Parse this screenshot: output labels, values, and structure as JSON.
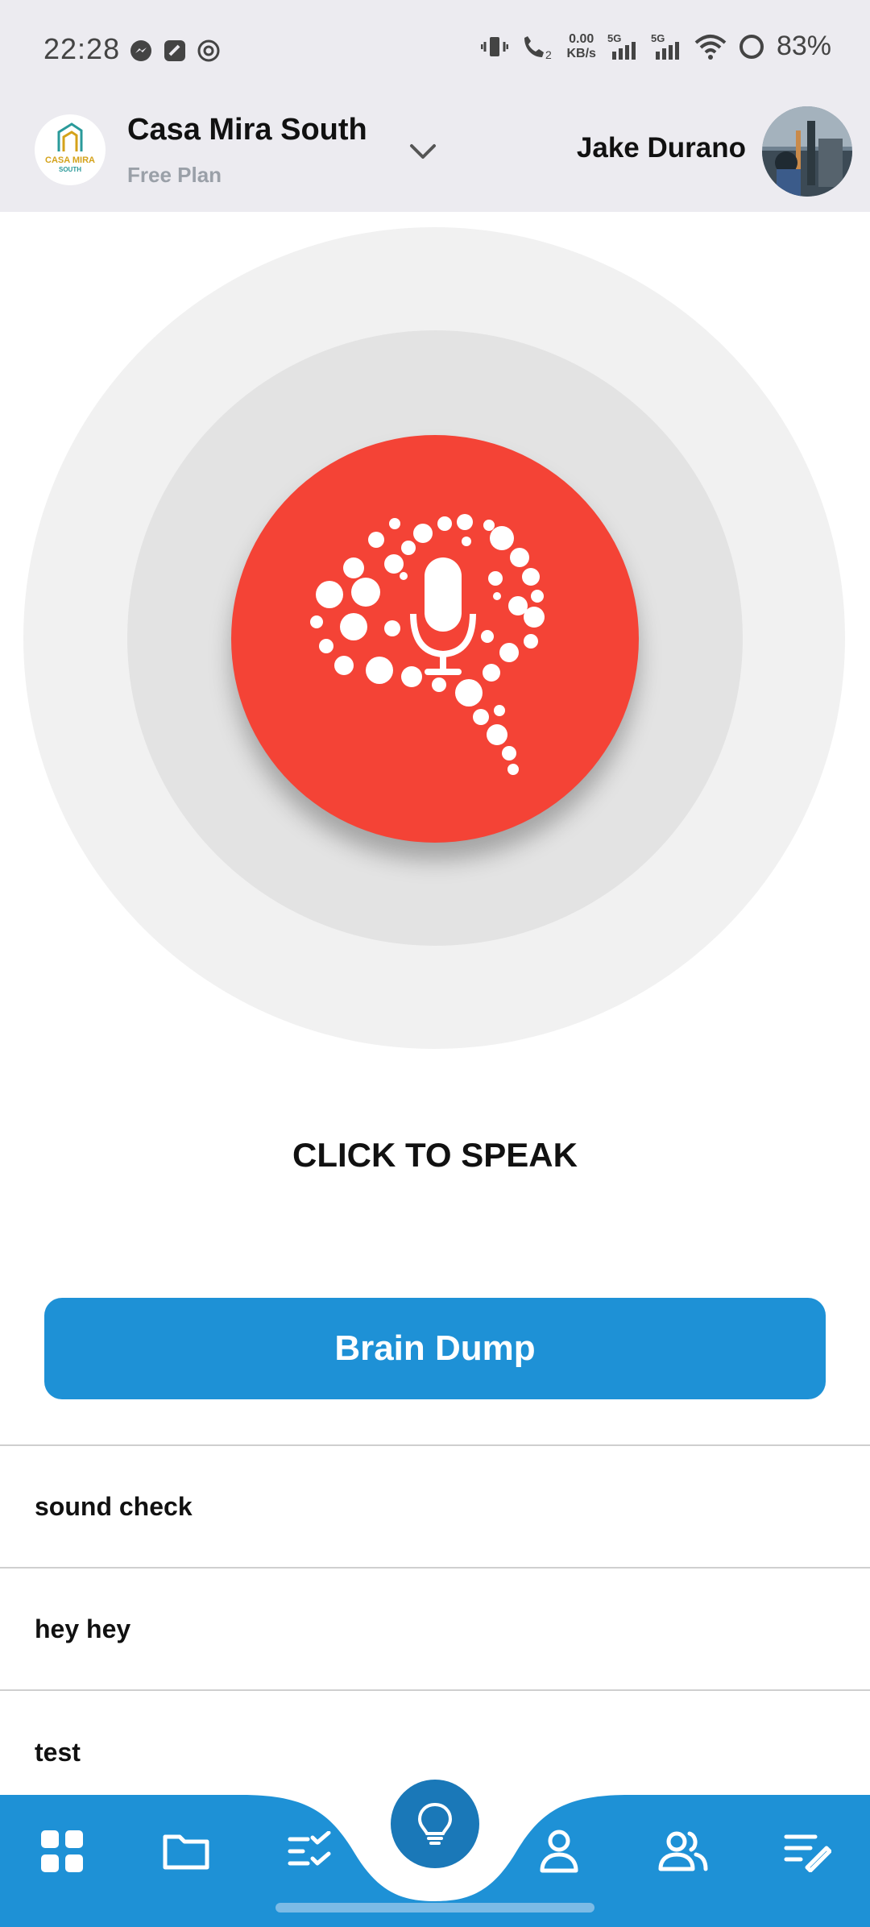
{
  "status_bar": {
    "time": "22:28",
    "net_speed": "0.00",
    "net_unit": "KB/s",
    "sim1": "5G",
    "sim2": "5G",
    "call_sim": "2",
    "battery": "83%"
  },
  "header": {
    "workspace_name": "Casa Mira South",
    "workspace_plan": "Free Plan",
    "logo_text": "CASA MIRA",
    "logo_subtext": "SOUTH",
    "user_name": "Jake Durano"
  },
  "speak": {
    "label": "CLICK TO SPEAK"
  },
  "brain_dump": {
    "label": "Brain Dump"
  },
  "entries": [
    {
      "text": "sound check"
    },
    {
      "text": "hey hey"
    },
    {
      "text": "test"
    }
  ],
  "nav": {
    "items": [
      "grid-icon",
      "folder-icon",
      "tasks-icon",
      "lightbulb-icon",
      "person-icon",
      "people-icon",
      "notes-edit-icon"
    ]
  },
  "colors": {
    "accent": "#1e91d6",
    "mic_red": "#f44336",
    "header_bg": "#ecebf0"
  }
}
